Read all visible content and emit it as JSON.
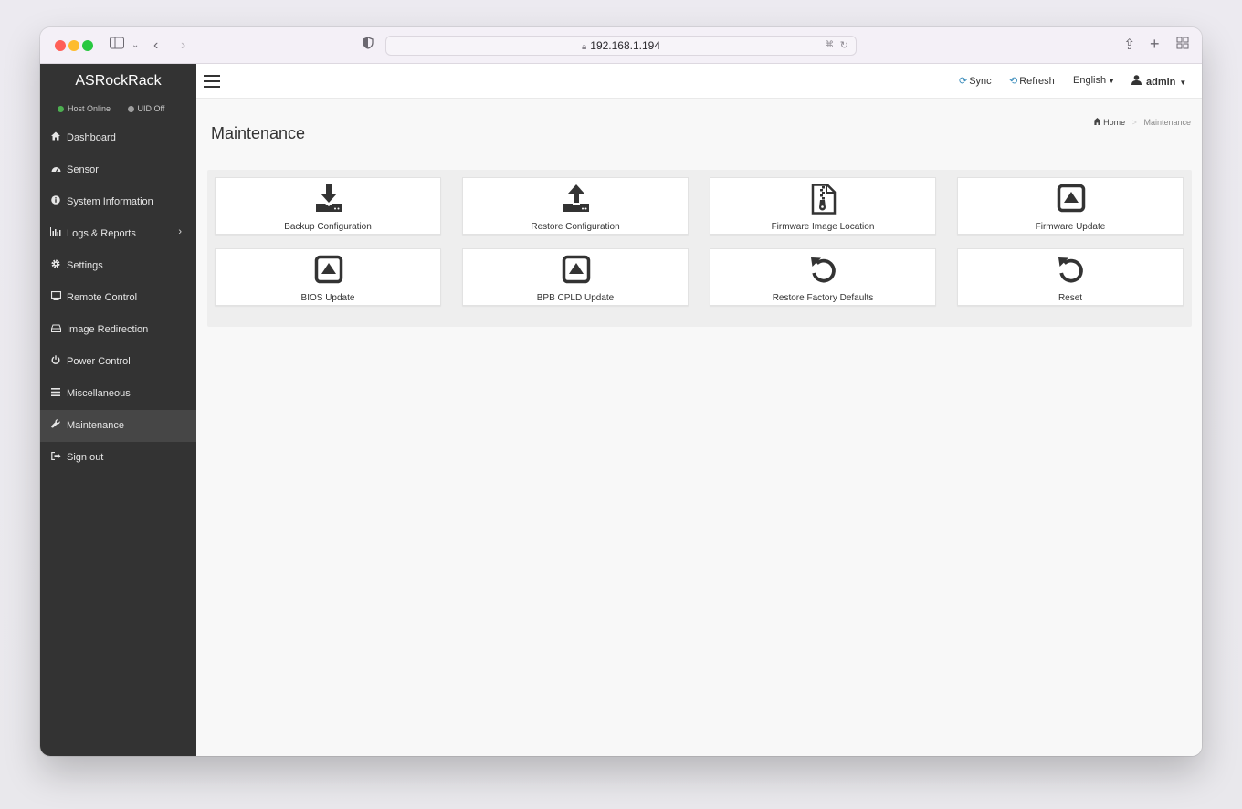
{
  "browser": {
    "url": "192.168.1.194"
  },
  "sidebar": {
    "brand": "ASRockRack",
    "status": [
      {
        "label": "Host Online",
        "color": "#4caf50"
      },
      {
        "label": "UID Off",
        "color": "#9e9e9e"
      }
    ],
    "items": [
      {
        "label": "Dashboard",
        "icon": "home-icon"
      },
      {
        "label": "Sensor",
        "icon": "tachometer-icon"
      },
      {
        "label": "System Information",
        "icon": "info-circle-icon"
      },
      {
        "label": "Logs & Reports",
        "icon": "bar-chart-icon"
      },
      {
        "label": "Settings",
        "icon": "gear-icon"
      },
      {
        "label": "Remote Control",
        "icon": "desktop-icon"
      },
      {
        "label": "Image Redirection",
        "icon": "hdd-icon"
      },
      {
        "label": "Power Control",
        "icon": "power-icon"
      },
      {
        "label": "Miscellaneous",
        "icon": "list-icon"
      },
      {
        "label": "Maintenance",
        "icon": "wrench-icon",
        "active": true
      },
      {
        "label": "Sign out",
        "icon": "sign-out-icon"
      }
    ]
  },
  "header": {
    "sync": "Sync",
    "refresh": "Refresh",
    "language": "English",
    "user": "admin",
    "accent": "#3c8dbc"
  },
  "page": {
    "title": "Maintenance",
    "breadcrumb": {
      "home": "Home",
      "current": "Maintenance"
    }
  },
  "tiles": [
    {
      "label": "Backup Configuration",
      "icon": "download-icon"
    },
    {
      "label": "Restore Configuration",
      "icon": "upload-icon"
    },
    {
      "label": "Firmware Image Location",
      "icon": "file-zip-icon"
    },
    {
      "label": "Firmware Update",
      "icon": "caret-up-square-icon"
    },
    {
      "label": "BIOS Update",
      "icon": "caret-up-square-icon"
    },
    {
      "label": "BPB CPLD Update",
      "icon": "caret-up-square-icon"
    },
    {
      "label": "Restore Factory Defaults",
      "icon": "undo-icon"
    },
    {
      "label": "Reset",
      "icon": "undo-icon"
    }
  ]
}
